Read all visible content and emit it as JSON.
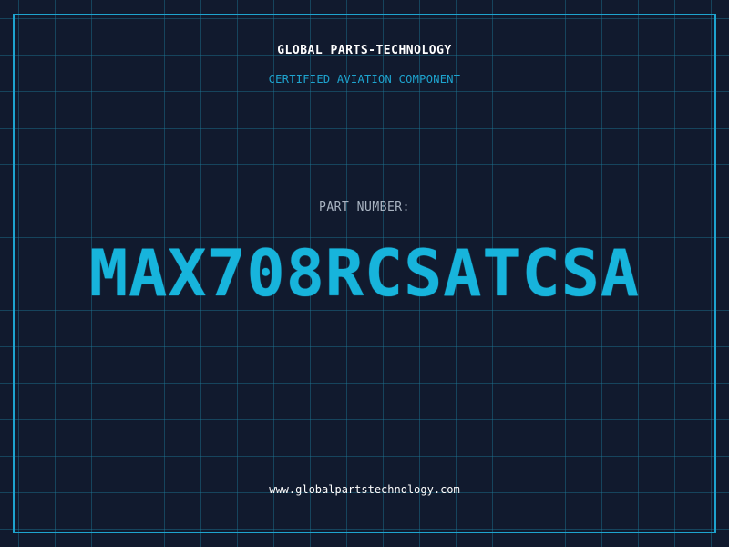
{
  "header": {
    "company": "GLOBAL PARTS-TECHNOLOGY",
    "subtitle": "CERTIFIED AVIATION COMPONENT"
  },
  "part": {
    "label": "PART NUMBER:",
    "number": "MAX708RCSATCSA"
  },
  "footer": {
    "website": "www.globalpartstechnology.com"
  },
  "colors": {
    "background": "#111a2e",
    "grid": "#1e7896",
    "accent": "#1ea4cf",
    "part_number": "#17b4dc",
    "label": "#a9b4c2",
    "text": "#ffffff"
  }
}
